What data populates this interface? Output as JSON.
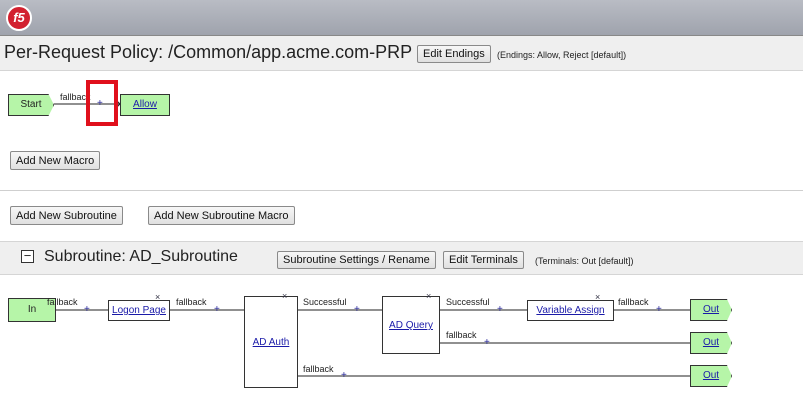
{
  "app": {
    "logo_text": "f5"
  },
  "policy": {
    "title": "Per-Request Policy: /Common/app.acme.com-PRP",
    "edit_endings_label": "Edit Endings",
    "endings_note": "(Endings: Allow, Reject [default])"
  },
  "main_flow": {
    "start_label": "Start",
    "fallback_label": "fallback",
    "add_item_glyph": "+",
    "allow_label": "Allow"
  },
  "buttons": {
    "add_macro": "Add New Macro",
    "add_subroutine": "Add New Subroutine",
    "add_subroutine_macro": "Add New Subroutine Macro"
  },
  "subroutine": {
    "collapse_glyph": "−",
    "title": "Subroutine: AD_Subroutine",
    "settings_label": "Subroutine Settings / Rename",
    "edit_terminals_label": "Edit Terminals",
    "terminals_note": "(Terminals: Out [default])",
    "in_label": "In",
    "logon_page": "Logon Page",
    "ad_auth": "AD Auth",
    "ad_query": "AD Query",
    "variable_assign": "Variable Assign",
    "out_label": "Out",
    "fallback": "fallback",
    "successful": "Successful",
    "delete_glyph": "×",
    "plus_glyph": "+"
  },
  "colors": {
    "terminal_green": "#b6f5a8",
    "link": "#1a1aa8",
    "highlight": "#e0101c"
  }
}
